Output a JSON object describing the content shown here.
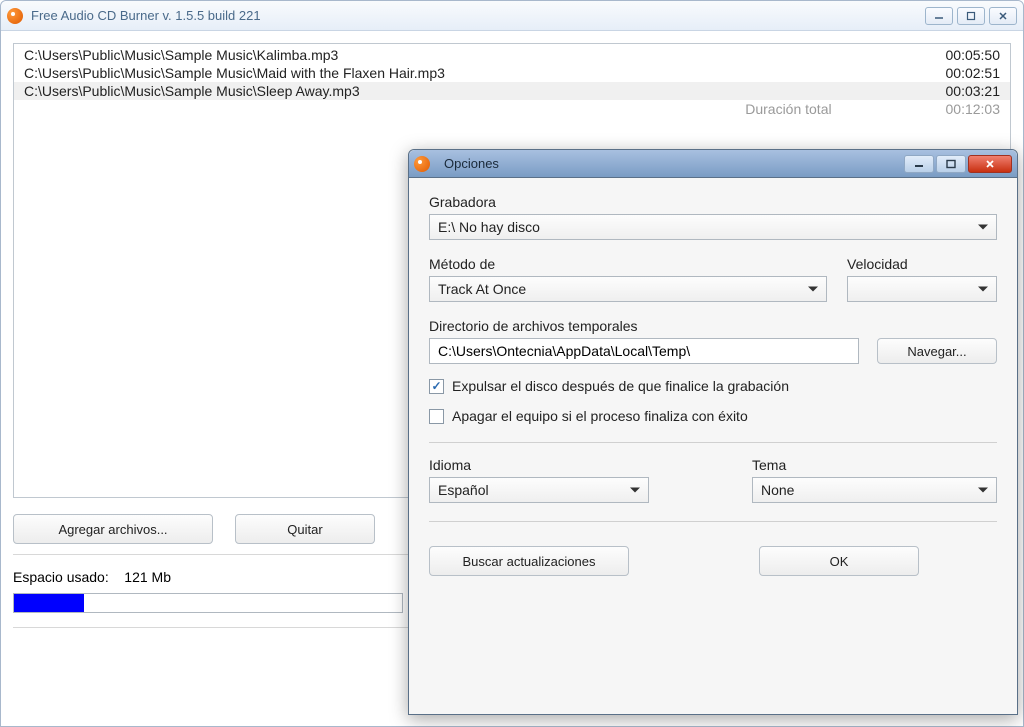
{
  "main": {
    "title": "Free Audio CD Burner  v. 1.5.5 build 221",
    "files": [
      {
        "path": "C:\\Users\\Public\\Music\\Sample Music\\Kalimba.mp3",
        "duration": "00:05:50"
      },
      {
        "path": "C:\\Users\\Public\\Music\\Sample Music\\Maid with the Flaxen Hair.mp3",
        "duration": "00:02:51"
      },
      {
        "path": "C:\\Users\\Public\\Music\\Sample Music\\Sleep Away.mp3",
        "duration": "00:03:21"
      }
    ],
    "total_label": "Duración total",
    "total_duration": "00:12:03",
    "buttons": {
      "add": "Agregar archivos...",
      "remove": "Quitar"
    },
    "space_used_label": "Espacio usado:",
    "space_used_value": "121 Mb"
  },
  "options": {
    "title": "Opciones",
    "recorder_label": "Grabadora",
    "recorder_value": "E:\\ No hay disco",
    "method_label": "Método de",
    "method_value": "Track At Once",
    "speed_label": "Velocidad",
    "speed_value": "",
    "tempdir_label": "Directorio de archivos temporales",
    "tempdir_value": "C:\\Users\\Ontecnia\\AppData\\Local\\Temp\\",
    "browse": "Navegar...",
    "eject_label": "Expulsar el disco después de que finalice la grabación",
    "shutdown_label": "Apagar el equipo si el proceso finaliza con éxito",
    "language_label": "Idioma",
    "language_value": "Español",
    "theme_label": "Tema",
    "theme_value": "None",
    "updates": "Buscar actualizaciones",
    "ok": "OK"
  }
}
